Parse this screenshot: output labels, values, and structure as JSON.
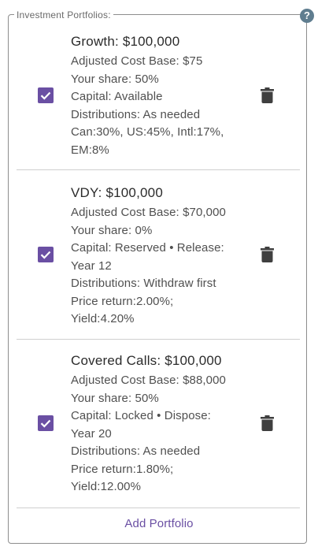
{
  "section": {
    "legend": "Investment Portfolios:",
    "help_icon": "?",
    "add_label": "Add Portfolio"
  },
  "portfolios": [
    {
      "title": "Growth: $100,000",
      "checked": true,
      "lines": [
        "Adjusted Cost Base: $75",
        "Your share: 50%",
        "Capital: Available",
        "Distributions: As needed",
        "Can:30%, US:45%, Intl:17%,",
        "EM:8%"
      ]
    },
    {
      "title": "VDY: $100,000",
      "checked": true,
      "lines": [
        "Adjusted Cost Base: $70,000",
        "Your share: 0%",
        "Capital: Reserved • Release:",
        "Year 12",
        "Distributions: Withdraw first",
        "Price return:2.00%;",
        "Yield:4.20%"
      ]
    },
    {
      "title": "Covered Calls: $100,000",
      "checked": true,
      "lines": [
        "Adjusted Cost Base: $88,000",
        "Your share: 50%",
        "Capital: Locked • Dispose:",
        "Year 20",
        "Distributions: As needed",
        "Price return:1.80%;",
        "Yield:12.00%"
      ]
    }
  ],
  "colors": {
    "accent": "#6a4fa3",
    "help_icon": "#5f7d8f",
    "trash": "#3f3f3f"
  }
}
